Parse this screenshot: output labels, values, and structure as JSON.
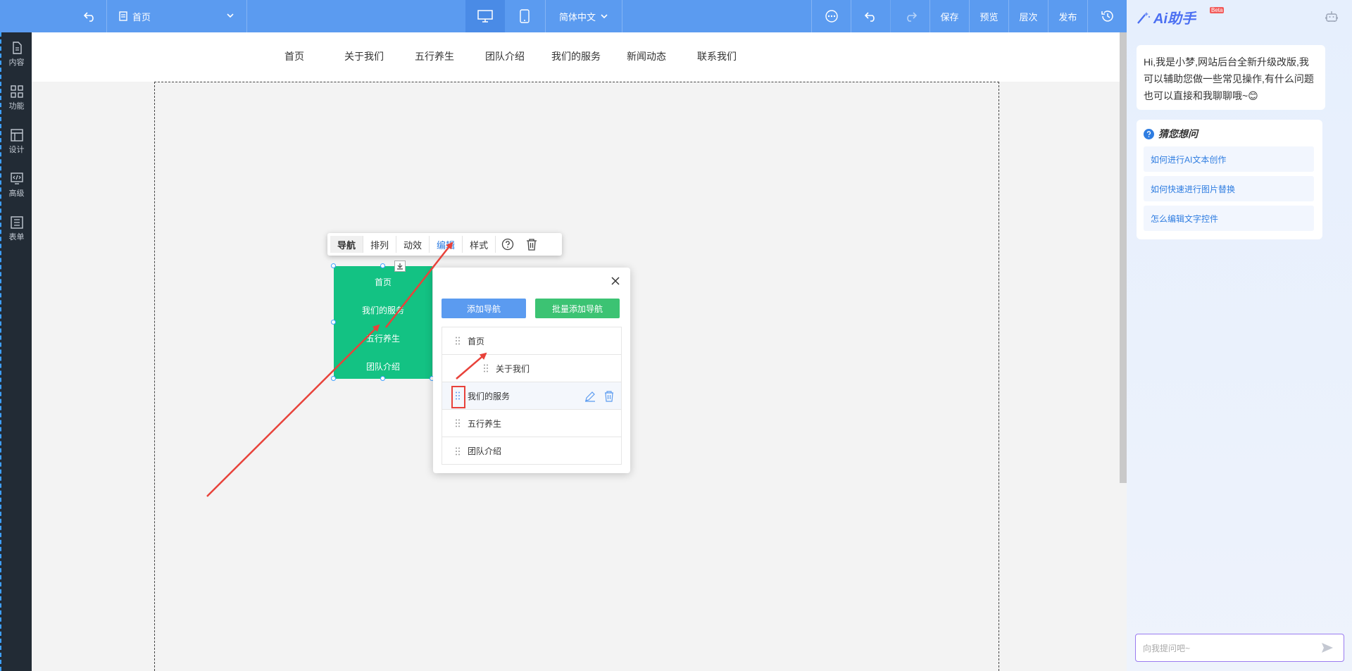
{
  "topbar": {
    "page_name": "首页",
    "language": "简体中文",
    "save": "保存",
    "preview": "预览",
    "layers": "层次",
    "publish": "发布"
  },
  "sidebar": {
    "items": [
      {
        "label": "内容",
        "icon": "document-icon"
      },
      {
        "label": "功能",
        "icon": "grid-icon"
      },
      {
        "label": "设计",
        "icon": "layout-icon"
      },
      {
        "label": "高级",
        "icon": "code-icon"
      },
      {
        "label": "表单",
        "icon": "form-icon"
      }
    ]
  },
  "site_nav": [
    "首页",
    "关于我们",
    "五行养生",
    "团队介绍",
    "我们的服务",
    "新闻动态",
    "联系我们"
  ],
  "toolbar": {
    "nav": "导航",
    "arrange": "排列",
    "animation": "动效",
    "edit": "编辑",
    "style": "样式"
  },
  "green_nav": [
    "首页",
    "我们的服务",
    "五行养生",
    "团队介绍"
  ],
  "popup": {
    "add_nav": "添加导航",
    "batch_add": "批量添加导航",
    "add_color": "#5b9bf0",
    "batch_color": "#3cc373",
    "items": [
      {
        "label": "首页",
        "sub": false
      },
      {
        "label": "关于我们",
        "sub": true
      },
      {
        "label": "我们的服务",
        "sub": false,
        "hover": true
      },
      {
        "label": "五行养生",
        "sub": false
      },
      {
        "label": "团队介绍",
        "sub": false
      }
    ]
  },
  "ai": {
    "title": "Ai助手",
    "beta": "Beta",
    "greeting": "Hi,我是小梦,网站后台全新升级改版,我可以辅助您做一些常见操作,有什么问题也可以直接和我聊聊哦~😊",
    "guess_title": "猜您想问",
    "questions": [
      "如何进行AI文本创作",
      "如何快速进行图片替换",
      "怎么编辑文字控件"
    ],
    "input_placeholder": "向我提问吧~"
  },
  "colors": {
    "topbar": "#5b9bf0",
    "sidebar": "#222b35",
    "green": "#13c283",
    "annotation_red": "#e8423a"
  }
}
